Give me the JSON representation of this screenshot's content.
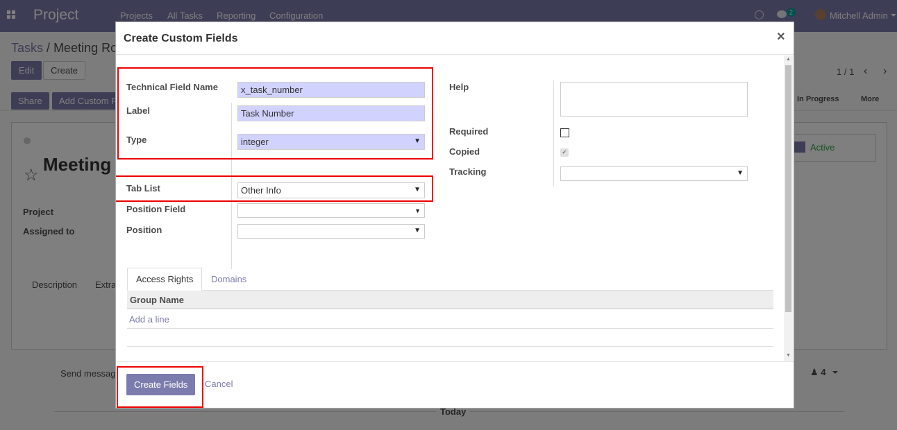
{
  "navbar": {
    "app_name": "Project",
    "menu": [
      "Projects",
      "All Tasks",
      "Reporting",
      "Configuration"
    ],
    "chat_count": "2",
    "user": "Mitchell Admin"
  },
  "breadcrumb": {
    "root": "Tasks",
    "separator": "/",
    "current": "Meeting Ro"
  },
  "buttons": {
    "edit": "Edit",
    "create": "Create",
    "share": "Share",
    "add_custom_field": "Add Custom F"
  },
  "pager": {
    "value": "1 / 1"
  },
  "stages": {
    "in_progress": "In Progress",
    "more": "More"
  },
  "record": {
    "title": "Meeting",
    "project_label": "Project",
    "assigned_label": "Assigned to",
    "tabs": [
      "Description",
      "Extra"
    ],
    "active_label": "Active",
    "send_message": "Send messag",
    "followers": "4",
    "today": "Today"
  },
  "modal": {
    "title": "Create Custom Fields",
    "close": "×",
    "fields": {
      "technical_name": {
        "label": "Technical Field Name",
        "value": "x_task_number"
      },
      "label": {
        "label": "Label",
        "value": "Task Number"
      },
      "type": {
        "label": "Type",
        "value": "integer"
      },
      "tab_list": {
        "label": "Tab List",
        "value": "Other Info"
      },
      "position_field": {
        "label": "Position Field",
        "value": ""
      },
      "position": {
        "label": "Position",
        "value": ""
      },
      "help": {
        "label": "Help",
        "value": ""
      },
      "required": {
        "label": "Required",
        "checked": false
      },
      "copied": {
        "label": "Copied",
        "checked": true
      },
      "tracking": {
        "label": "Tracking",
        "value": ""
      }
    },
    "tabs": [
      "Access Rights",
      "Domains"
    ],
    "table": {
      "header": "Group Name",
      "add_line": "Add a line"
    },
    "footer": {
      "create": "Create Fields",
      "cancel": "Cancel"
    }
  },
  "colors": {
    "brand": "#7c7bad",
    "highlight": "#ee0000",
    "required_bg": "#d2d2ff"
  }
}
